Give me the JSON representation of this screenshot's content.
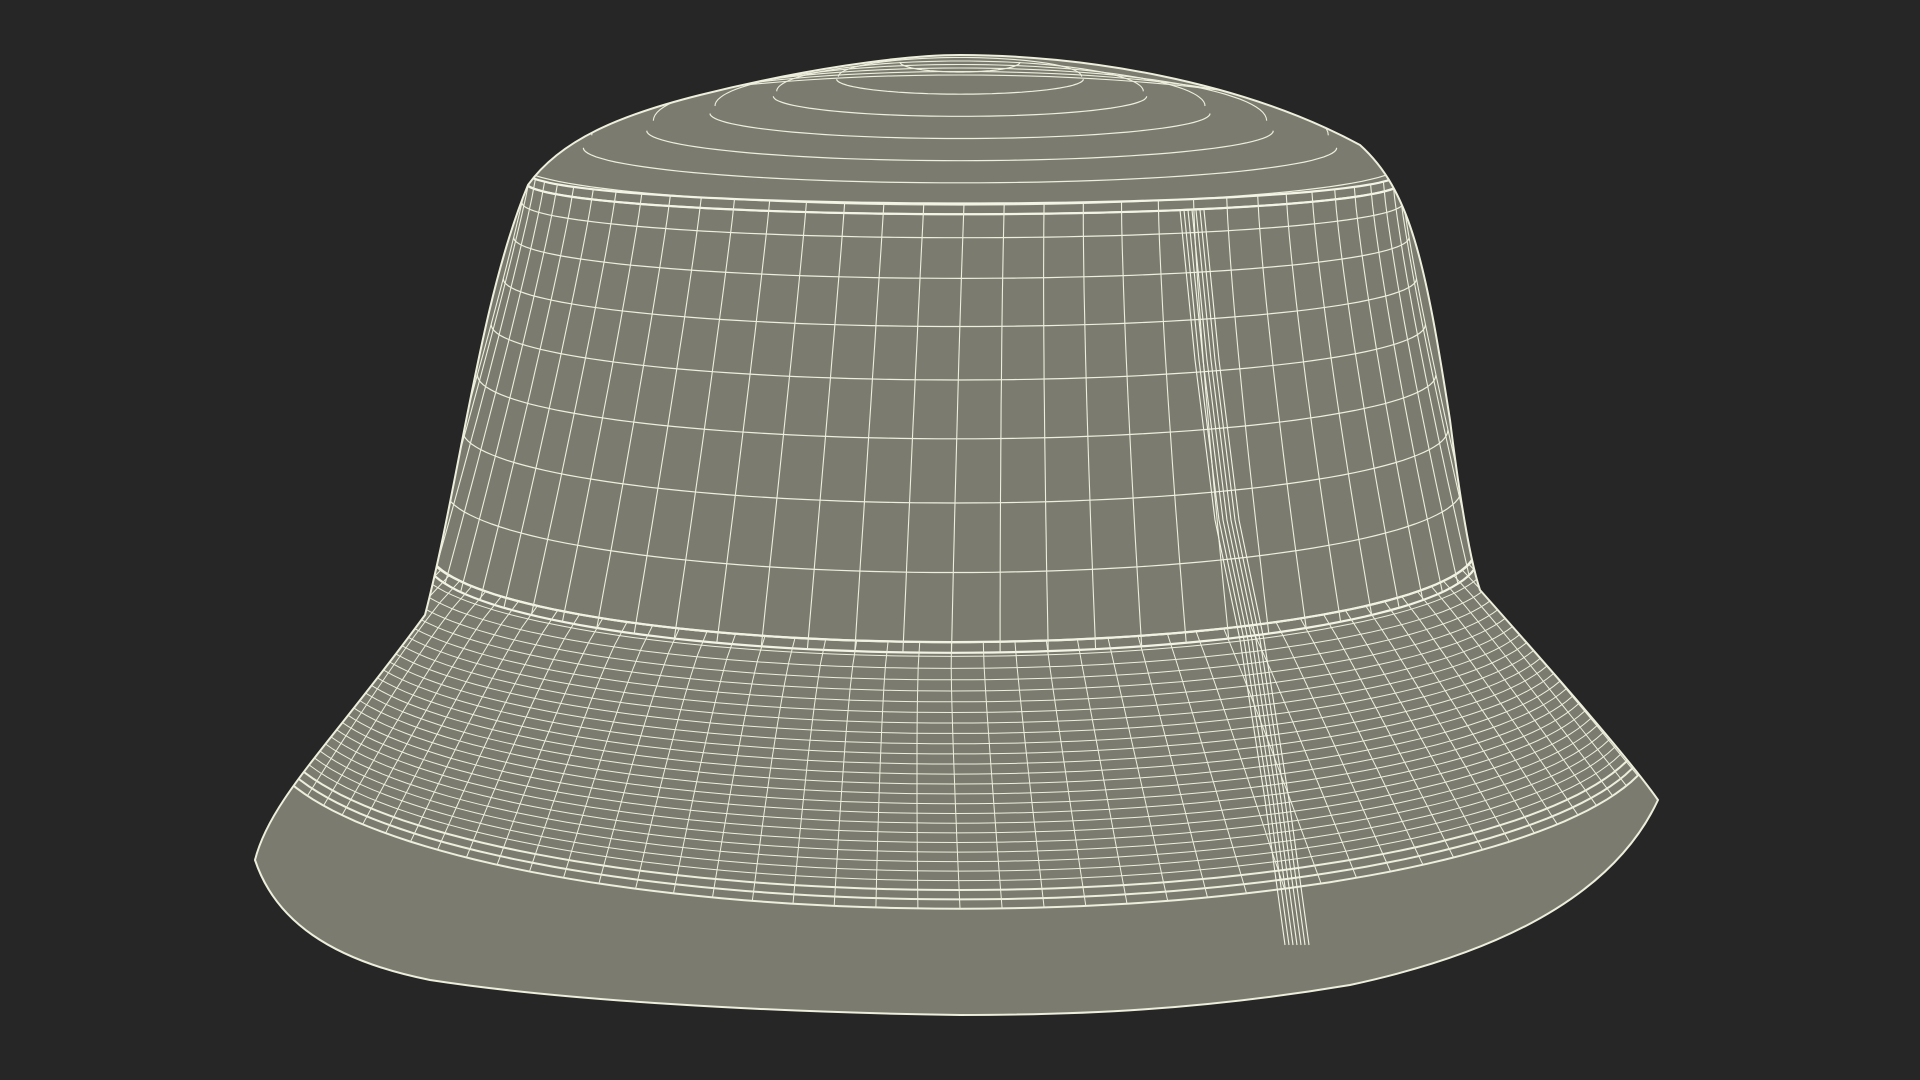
{
  "scene": {
    "subject": "bucket-hat",
    "render_style": "wireframe",
    "colors": {
      "background": "#262626",
      "mesh_fill": "#7b7c6f",
      "wire": "#eeeedd",
      "wire_dense": "#f4f4e6",
      "shadow": "#5f6055"
    }
  }
}
